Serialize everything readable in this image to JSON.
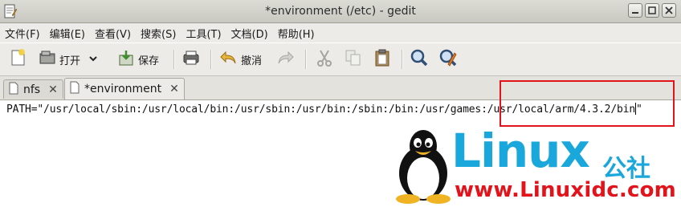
{
  "window": {
    "title": "*environment (/etc) - gedit",
    "controls": [
      "minimize-icon",
      "maximize-icon",
      "close-icon"
    ]
  },
  "menubar": {
    "items": [
      "文件(F)",
      "编辑(E)",
      "查看(V)",
      "搜索(S)",
      "工具(T)",
      "文档(D)",
      "帮助(H)"
    ]
  },
  "toolbar": {
    "new_icon": "new-document-icon",
    "open_label": "打开",
    "save_label": "保存",
    "print_icon": "print-icon",
    "undo_label": "撤消",
    "redo_icon": "redo-icon",
    "cut_icon": "cut-icon",
    "copy_icon": "copy-icon",
    "paste_icon": "paste-icon",
    "find_icon": "find-icon",
    "replace_icon": "find-replace-icon"
  },
  "tabs": [
    {
      "label": "nfs",
      "active": false
    },
    {
      "label": "*environment",
      "active": true
    }
  ],
  "editor": {
    "line1": "PATH=\"/usr/local/sbin:/usr/local/bin:/usr/sbin:/usr/bin:/sbin:/bin:/usr/games:/usr/local/arm/4.3.2/bin",
    "line1_end": "\""
  },
  "watermark": {
    "brand": "Linux",
    "brand_cn": "公社",
    "url": "www.Linuxidc.com"
  },
  "colors": {
    "highlight": "#e3131b",
    "watermark_blue": "#1aa7dc",
    "watermark_red": "#e3131b"
  }
}
